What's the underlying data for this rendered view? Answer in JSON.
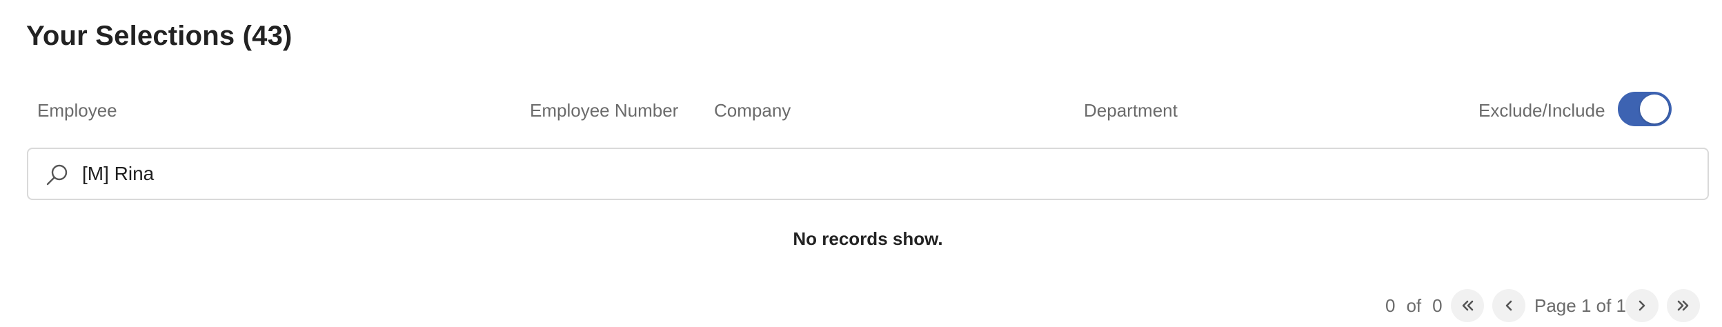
{
  "page": {
    "title": "Your Selections (43)"
  },
  "columns": {
    "employee": "Employee",
    "employee_number": "Employee Number",
    "company": "Company",
    "department": "Department",
    "exclude_include": "Exclude/Include"
  },
  "toggle": {
    "state": "on",
    "color": "#3d63b2"
  },
  "search": {
    "value": "[M] Rina",
    "icon": "search-icon"
  },
  "results": {
    "empty_message": "No records show."
  },
  "pagination": {
    "range_start": "0",
    "of_label": "of",
    "total": "0",
    "page_label": "Page 1 of 1",
    "first_icon": "double-chevron-left-icon",
    "prev_icon": "chevron-left-icon",
    "next_icon": "chevron-right-icon",
    "last_icon": "double-chevron-right-icon"
  }
}
